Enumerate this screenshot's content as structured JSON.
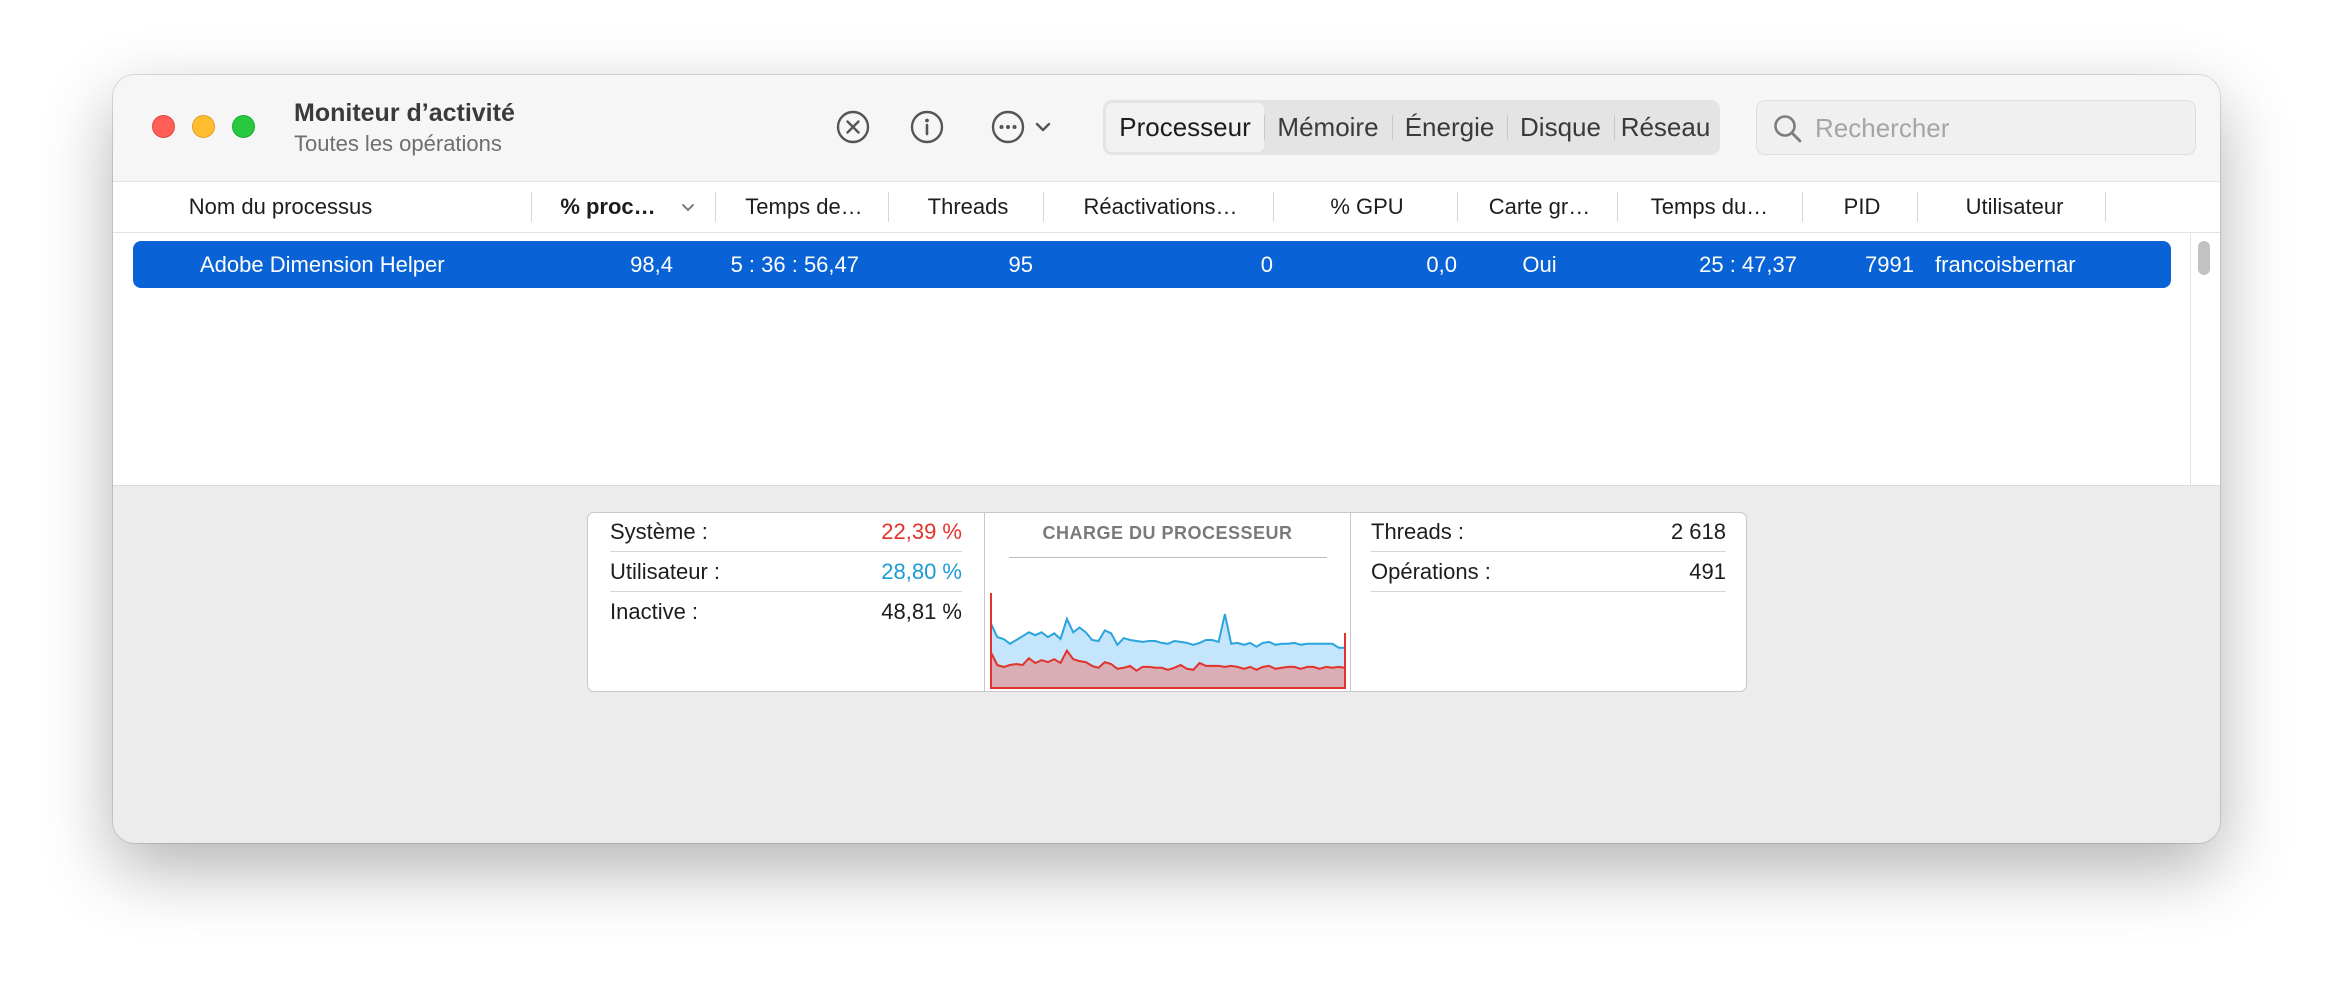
{
  "window": {
    "title": "Moniteur d’activité",
    "subtitle": "Toutes les opérations"
  },
  "toolbar": {
    "icons": [
      "stop-process-icon",
      "info-icon",
      "more-options-icon",
      "chevron-down-icon"
    ],
    "tabs": [
      {
        "label": "Processeur",
        "active": true
      },
      {
        "label": "Mémoire",
        "active": false
      },
      {
        "label": "Énergie",
        "active": false
      },
      {
        "label": "Disque",
        "active": false
      },
      {
        "label": "Réseau",
        "active": false
      }
    ],
    "search": {
      "placeholder": "Rechercher",
      "value": ""
    }
  },
  "table": {
    "columns": [
      "Nom du processus",
      "% proc…",
      "Temps de…",
      "Threads",
      "Réactivations…",
      "% GPU",
      "Carte gr…",
      "Temps du…",
      "PID",
      "Utilisateur"
    ],
    "sorted_column": "% proc…",
    "rows": [
      {
        "name": "Adobe Dimension Helper",
        "cpu": "98,4",
        "cpu_time": "5 : 36 : 56,47",
        "threads": "95",
        "wakeups": "0",
        "gpu": "0,0",
        "graphics": "Oui",
        "gpu_time": "25 : 47,37",
        "pid": "7991",
        "user": "francoisbernar",
        "selected": true
      }
    ]
  },
  "summary": {
    "left": [
      {
        "label": "Système :",
        "value": "22,39 %",
        "color": "#e0332b"
      },
      {
        "label": "Utilisateur :",
        "value": "28,80 %",
        "color": "#1c9bd6"
      },
      {
        "label": "Inactive :",
        "value": "48,81 %",
        "color": "#1d1d1f"
      }
    ],
    "right": [
      {
        "label": "Threads :",
        "value": "2 618"
      },
      {
        "label": "Opérations :",
        "value": "491"
      }
    ]
  },
  "chart_data": {
    "type": "area",
    "title": "CHARGE DU PROCESSEUR",
    "ylim": [
      0,
      100
    ],
    "series": [
      {
        "color": "#e0332b",
        "values": [
          37,
          24,
          22,
          24,
          25,
          24,
          31,
          26,
          29,
          27,
          30,
          26,
          39,
          30,
          28,
          27,
          23,
          21,
          27,
          25,
          20,
          21,
          23,
          18,
          22,
          22,
          21,
          21,
          19,
          21,
          24,
          20,
          19,
          26,
          23,
          23,
          23,
          22,
          23,
          22,
          20,
          22,
          19,
          22,
          23,
          20,
          21,
          22,
          22,
          20,
          22,
          22,
          20,
          22,
          21,
          22,
          21
        ]
      },
      {
        "color": "#1c9bd6",
        "values": [
          30,
          29,
          29,
          22,
          25,
          30,
          27,
          29,
          29,
          26,
          27,
          25,
          33,
          28,
          35,
          31,
          27,
          28,
          33,
          32,
          25,
          31,
          27,
          31,
          26,
          27,
          28,
          26,
          27,
          28,
          24,
          27,
          26,
          21,
          27,
          27,
          25,
          55,
          23,
          25,
          25,
          25,
          24,
          25,
          25,
          25,
          25,
          24,
          25,
          25,
          24,
          24,
          26,
          24,
          25,
          20,
          21
        ]
      }
    ]
  }
}
